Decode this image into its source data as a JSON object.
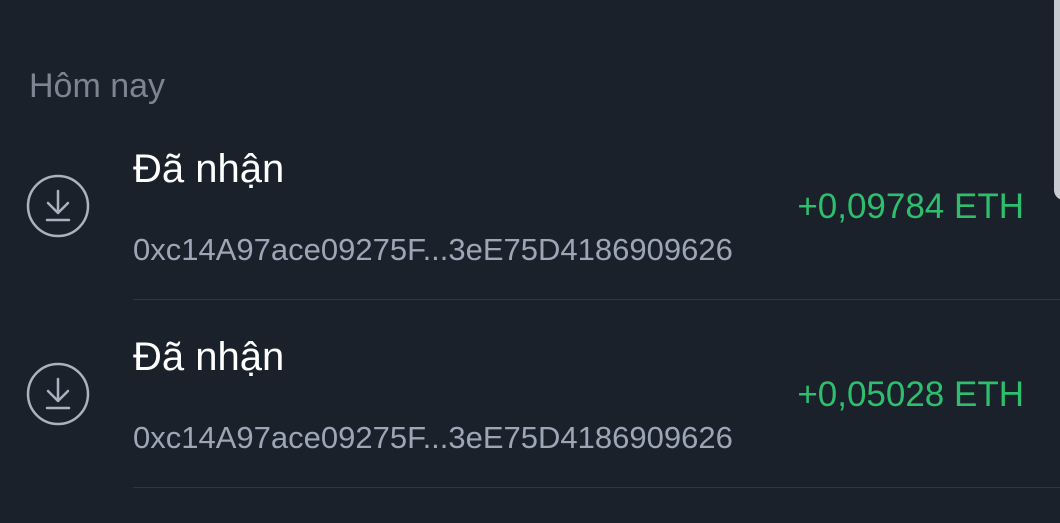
{
  "section": {
    "title": "Hôm nay"
  },
  "transactions": [
    {
      "icon": "receive-download-icon",
      "title": "Đã nhận",
      "address": "0xc14A97ace09275F...3eE75D4186909626",
      "amount": "+0,09784 ETH"
    },
    {
      "icon": "receive-download-icon",
      "title": "Đã nhận",
      "address": "0xc14A97ace09275F...3eE75D4186909626",
      "amount": "+0,05028 ETH"
    }
  ],
  "colors": {
    "background": "#1b212b",
    "positive": "#2dbf6e",
    "muted": "#9ca6b6"
  }
}
